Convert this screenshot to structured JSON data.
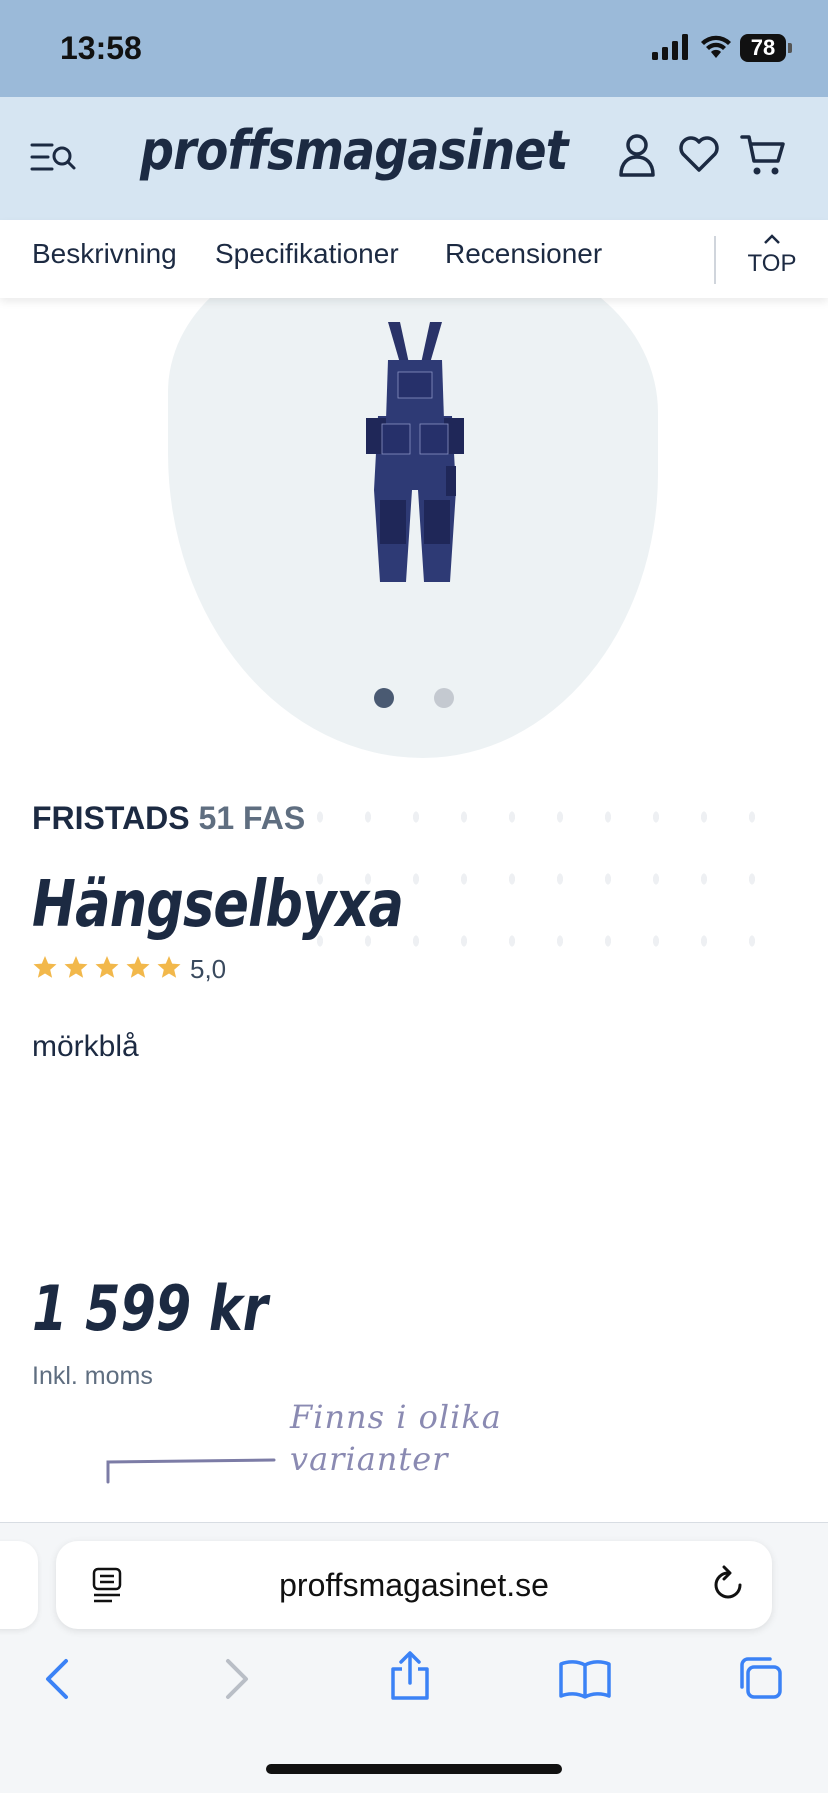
{
  "status_bar": {
    "time": "13:58",
    "battery": "78"
  },
  "header": {
    "logo": "proffsmagasinet",
    "icons": [
      "menu-search-icon",
      "user-icon",
      "heart-icon",
      "cart-icon"
    ]
  },
  "tabs": {
    "items": [
      "Beskrivning",
      "Specifikationer",
      "Recensioner"
    ],
    "top_label": "TOP"
  },
  "gallery": {
    "slide_count": 2,
    "active_slide": 1
  },
  "product": {
    "brand": "FRISTADS",
    "model": "51 FAS",
    "title": "Hängselbyxa",
    "rating": 5.0,
    "rating_label": "5,0",
    "color": "mörkblå",
    "price": "1 599 kr",
    "vat_note": "Inkl. moms",
    "variants_note_line1": "Finns i olika",
    "variants_note_line2": "varianter"
  },
  "browser": {
    "url": "proffsmagasinet.se"
  },
  "colors": {
    "status_bg": "#9bbad9",
    "header_bg": "#d6e5f2",
    "text_dark": "#1c2a42",
    "star": "#f2b84b",
    "accent_link": "#3b82f6"
  }
}
